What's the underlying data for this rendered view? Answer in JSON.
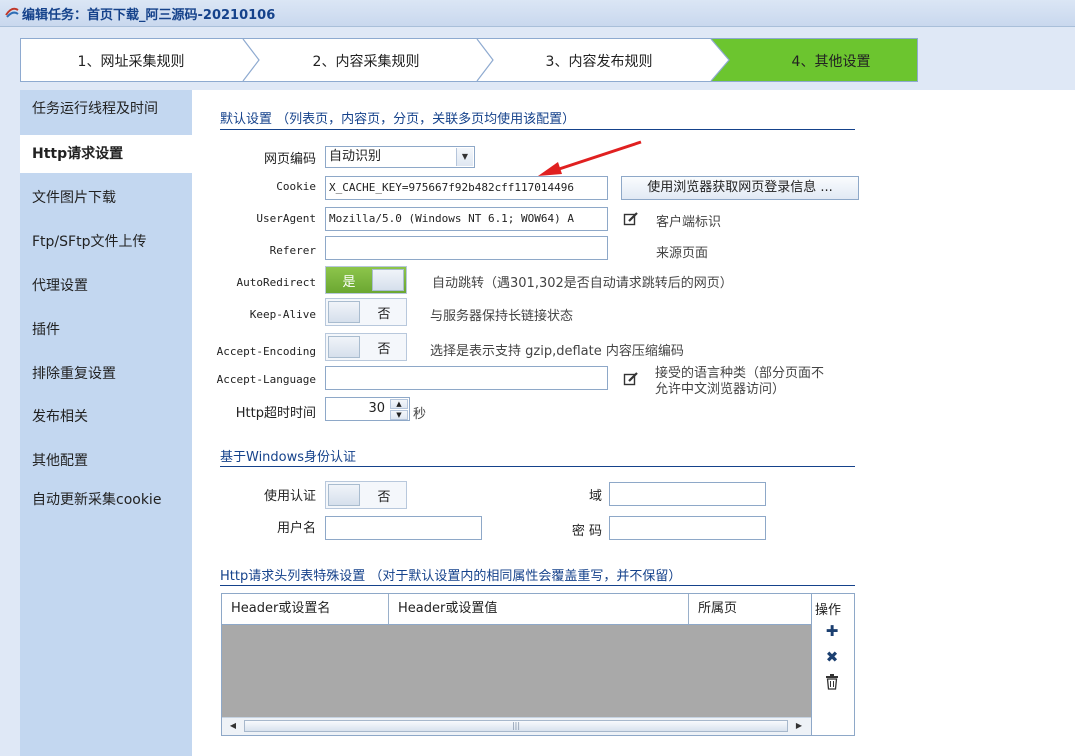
{
  "window": {
    "title": "编辑任务：首页下载_阿三源码-20210106"
  },
  "steps": [
    {
      "label": "1、网址采集规则"
    },
    {
      "label": "2、内容采集规则"
    },
    {
      "label": "3、内容发布规则"
    },
    {
      "label": "4、其他设置"
    }
  ],
  "sidebar": {
    "items": [
      {
        "label": "任务运行线程及时间"
      },
      {
        "label": "Http请求设置"
      },
      {
        "label": "文件图片下载"
      },
      {
        "label": "Ftp/SFtp文件上传"
      },
      {
        "label": "代理设置"
      },
      {
        "label": "插件"
      },
      {
        "label": "排除重复设置"
      },
      {
        "label": "发布相关"
      },
      {
        "label": "其他配置"
      },
      {
        "label": "自动更新采集cookie"
      }
    ]
  },
  "defaults": {
    "title": "默认设置 （列表页，内容页，分页，关联多页均使用该配置）",
    "encoding": {
      "label": "网页编码",
      "value": "自动识别"
    },
    "cookie": {
      "label": "Cookie",
      "value": "X_CACHE_KEY=975667f92b482cff117014496",
      "button": "使用浏览器获取网页登录信息 ..."
    },
    "useragent": {
      "label": "UserAgent",
      "value": "Mozilla/5.0 (Windows NT 6.1; WOW64) A",
      "hint": "客户端标识"
    },
    "referer": {
      "label": "Referer",
      "value": "",
      "hint": "来源页面"
    },
    "autoredirect": {
      "label": "AutoRedirect",
      "state": "是",
      "hint": "自动跳转（遇301,302是否自动请求跳转后的网页）"
    },
    "keepalive": {
      "label": "Keep-Alive",
      "state": "否",
      "hint": "与服务器保持长链接状态"
    },
    "acceptencoding": {
      "label": "Accept-Encoding",
      "state": "否",
      "hint": "选择是表示支持 gzip,deflate 内容压缩编码"
    },
    "acceptlanguage": {
      "label": "Accept-Language",
      "value": "",
      "hint1": "接受的语言种类（部分页面不",
      "hint2": "允许中文浏览器访问）"
    },
    "timeout": {
      "label": "Http超时时间",
      "value": "30",
      "unit": "秒"
    }
  },
  "windows_auth": {
    "title": "基于Windows身份认证",
    "use": {
      "label": "使用认证",
      "state": "否"
    },
    "domain": {
      "label": "域",
      "value": ""
    },
    "username": {
      "label": "用户名",
      "value": ""
    },
    "password": {
      "label": "密 码",
      "value": ""
    }
  },
  "headers": {
    "title": "Http请求头列表特殊设置 （对于默认设置内的相同属性会覆盖重写，并不保留）",
    "columns": [
      "Header或设置名",
      "Header或设置值",
      "所属页"
    ],
    "ops_label": "操作"
  },
  "colors": {
    "accent": "#15428b",
    "active_step": "#6bbf2a",
    "toggle_on": "#7cb53f"
  }
}
